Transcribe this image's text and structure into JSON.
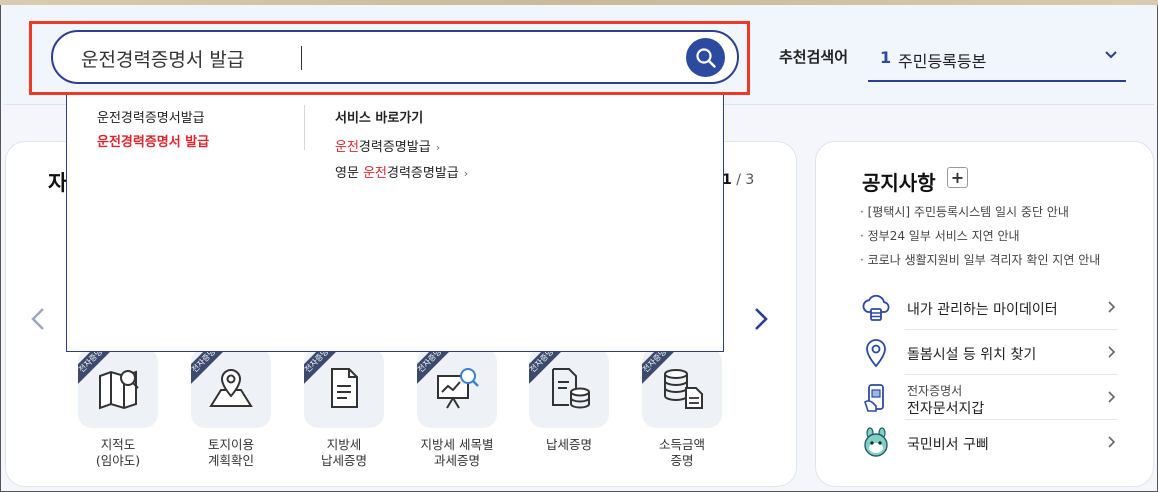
{
  "search": {
    "value": "운전경력증명서 발급"
  },
  "recommended": {
    "label": "추천검색어",
    "number": "1",
    "selected": "주민등록등본"
  },
  "dropdown": {
    "suggestions": [
      "운전경력증명서발급",
      "운전경력증명서 발급"
    ],
    "service_heading": "서비스 바로가기",
    "links": [
      {
        "prefix": "",
        "highlight": "운전",
        "rest": "경력증명발급"
      },
      {
        "prefix": "영문 ",
        "highlight": "운전",
        "rest": "경력증명발급"
      }
    ],
    "chevron": "›"
  },
  "main_card": {
    "title_fragment": "자",
    "pager_current": "1",
    "pager_total": " / 3",
    "badge": "전자증명",
    "services": [
      {
        "label_1": "지적도",
        "label_2": "(임야도)",
        "icon": "map-icon"
      },
      {
        "label_1": "토지이용",
        "label_2": "계획확인",
        "icon": "land-map-pin-icon"
      },
      {
        "label_1": "지방세",
        "label_2": "납세증명",
        "icon": "document-icon"
      },
      {
        "label_1": "지방세 세목별",
        "label_2": "과세증명",
        "icon": "chart-search-icon"
      },
      {
        "label_1": "납세증명",
        "label_2": "",
        "icon": "document-database-icon"
      },
      {
        "label_1": "소득금액",
        "label_2": "증명",
        "icon": "coins-document-icon"
      }
    ]
  },
  "notices": {
    "title": "공지사항",
    "plus": "+",
    "items": [
      "· [평택시] 주민등록시스템 일시 중단 안내",
      "· 정부24 일부 서비스 지연 안내",
      "· 코로나 생활지원비 일부 격리자 확인 지연 안내"
    ]
  },
  "quick_links": [
    {
      "label": "내가 관리하는 마이데이터",
      "icon": "cloud-data-icon"
    },
    {
      "label": "돌봄시설 등 위치 찾기",
      "icon": "location-pin-icon"
    },
    {
      "label_small": "전자증명서",
      "label": "전자문서지갑",
      "icon": "phone-wallet-icon"
    },
    {
      "label": "국민비서 구삐",
      "icon": "gubbi-mascot-icon"
    }
  ],
  "colors": {
    "brand": "#2b3f8f",
    "search_button": "#2b4aa0",
    "highlight_red": "#d7282f",
    "annotation_outline": "#ee3a24"
  }
}
